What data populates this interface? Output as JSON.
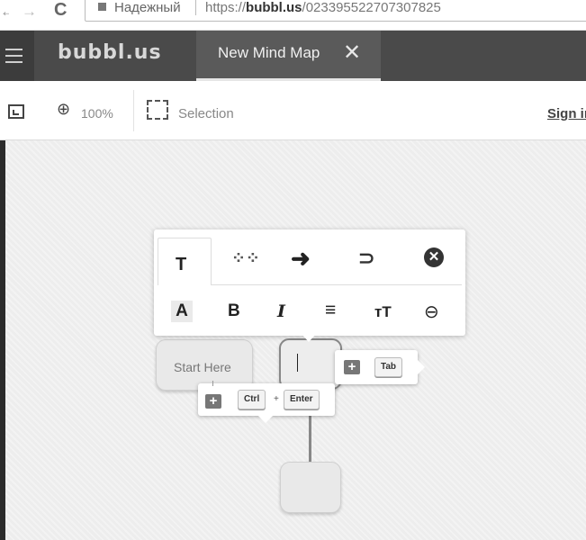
{
  "browser": {
    "secure_label": "Надежный",
    "url_prefix": "https://",
    "url_host": "bubbl.us",
    "url_path": "/023395522707307825"
  },
  "appbar": {
    "logo": "bubbl.us",
    "tab_title": "New Mind Map",
    "tab_close": "✕"
  },
  "toolbar": {
    "zoom": "100%",
    "selection_label": "Selection",
    "signin_label": "Sign in"
  },
  "canvas": {
    "start_bubble_text": "Start Here"
  },
  "format_popup": {
    "tabs": [
      "T",
      "layout-icon",
      "arrow-icon",
      "attachment-icon",
      "close-icon"
    ],
    "tab_text": "T",
    "close_glyph": "✕",
    "row": {
      "color": "A",
      "bold": "B",
      "italic": "I",
      "align": "≡",
      "size": "тT",
      "link": "⊖"
    }
  },
  "hints": {
    "tab_key": "Tab",
    "ctrl_key": "Ctrl",
    "plus": "+",
    "enter_key": "Enter",
    "add_glyph": "+"
  }
}
